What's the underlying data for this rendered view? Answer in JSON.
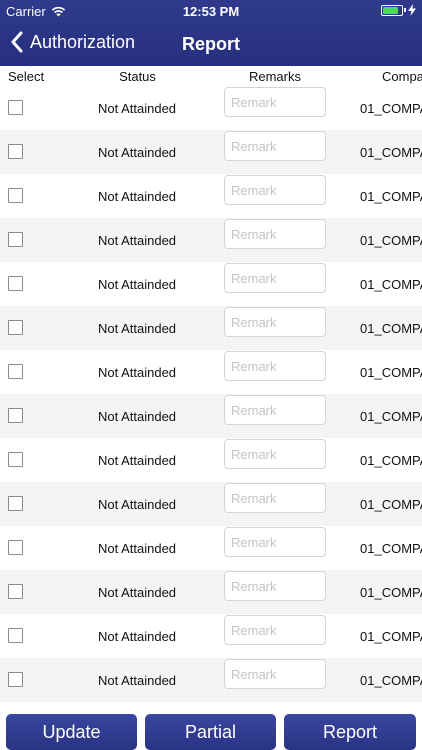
{
  "status_bar": {
    "carrier": "Carrier",
    "time": "12:53 PM",
    "battery_level": 0.85,
    "wifi_icon": "wifi-icon",
    "bolt_icon": "charging-bolt-icon"
  },
  "nav": {
    "back_label": "Authorization",
    "title": "Report"
  },
  "columns": {
    "select": "Select",
    "status": "Status",
    "remarks": "Remarks",
    "company": "Compa"
  },
  "rows": [
    {
      "status": "Not Attainded",
      "remark_placeholder": "Remark",
      "remark_value": "",
      "company": "01_COMPA",
      "checked": false
    },
    {
      "status": "Not Attainded",
      "remark_placeholder": "Remark",
      "remark_value": "",
      "company": "01_COMPA",
      "checked": false
    },
    {
      "status": "Not Attainded",
      "remark_placeholder": "Remark",
      "remark_value": "",
      "company": "01_COMPA",
      "checked": false
    },
    {
      "status": "Not Attainded",
      "remark_placeholder": "Remark",
      "remark_value": "",
      "company": "01_COMPA",
      "checked": false
    },
    {
      "status": "Not Attainded",
      "remark_placeholder": "Remark",
      "remark_value": "",
      "company": "01_COMPA",
      "checked": false
    },
    {
      "status": "Not Attainded",
      "remark_placeholder": "Remark",
      "remark_value": "",
      "company": "01_COMPA",
      "checked": false
    },
    {
      "status": "Not Attainded",
      "remark_placeholder": "Remark",
      "remark_value": "",
      "company": "01_COMPA",
      "checked": false
    },
    {
      "status": "Not Attainded",
      "remark_placeholder": "Remark",
      "remark_value": "",
      "company": "01_COMPA",
      "checked": false
    },
    {
      "status": "Not Attainded",
      "remark_placeholder": "Remark",
      "remark_value": "",
      "company": "01_COMPA",
      "checked": false
    },
    {
      "status": "Not Attainded",
      "remark_placeholder": "Remark",
      "remark_value": "",
      "company": "01_COMPA",
      "checked": false
    },
    {
      "status": "Not Attainded",
      "remark_placeholder": "Remark",
      "remark_value": "",
      "company": "01_COMPA",
      "checked": false
    },
    {
      "status": "Not Attainded",
      "remark_placeholder": "Remark",
      "remark_value": "",
      "company": "01_COMPA",
      "checked": false
    },
    {
      "status": "Not Attainded",
      "remark_placeholder": "Remark",
      "remark_value": "",
      "company": "01_COMPA",
      "checked": false
    },
    {
      "status": "Not Attainded",
      "remark_placeholder": "Remark",
      "remark_value": "",
      "company": "01_COMPA",
      "checked": false
    }
  ],
  "footer": {
    "update_label": "Update",
    "partial_label": "Partial",
    "report_label": "Report"
  },
  "colors": {
    "header": "#2f3a8c",
    "button": "#2f3a8c",
    "row_alt": "#f4f4f4",
    "battery": "#4cd964"
  }
}
